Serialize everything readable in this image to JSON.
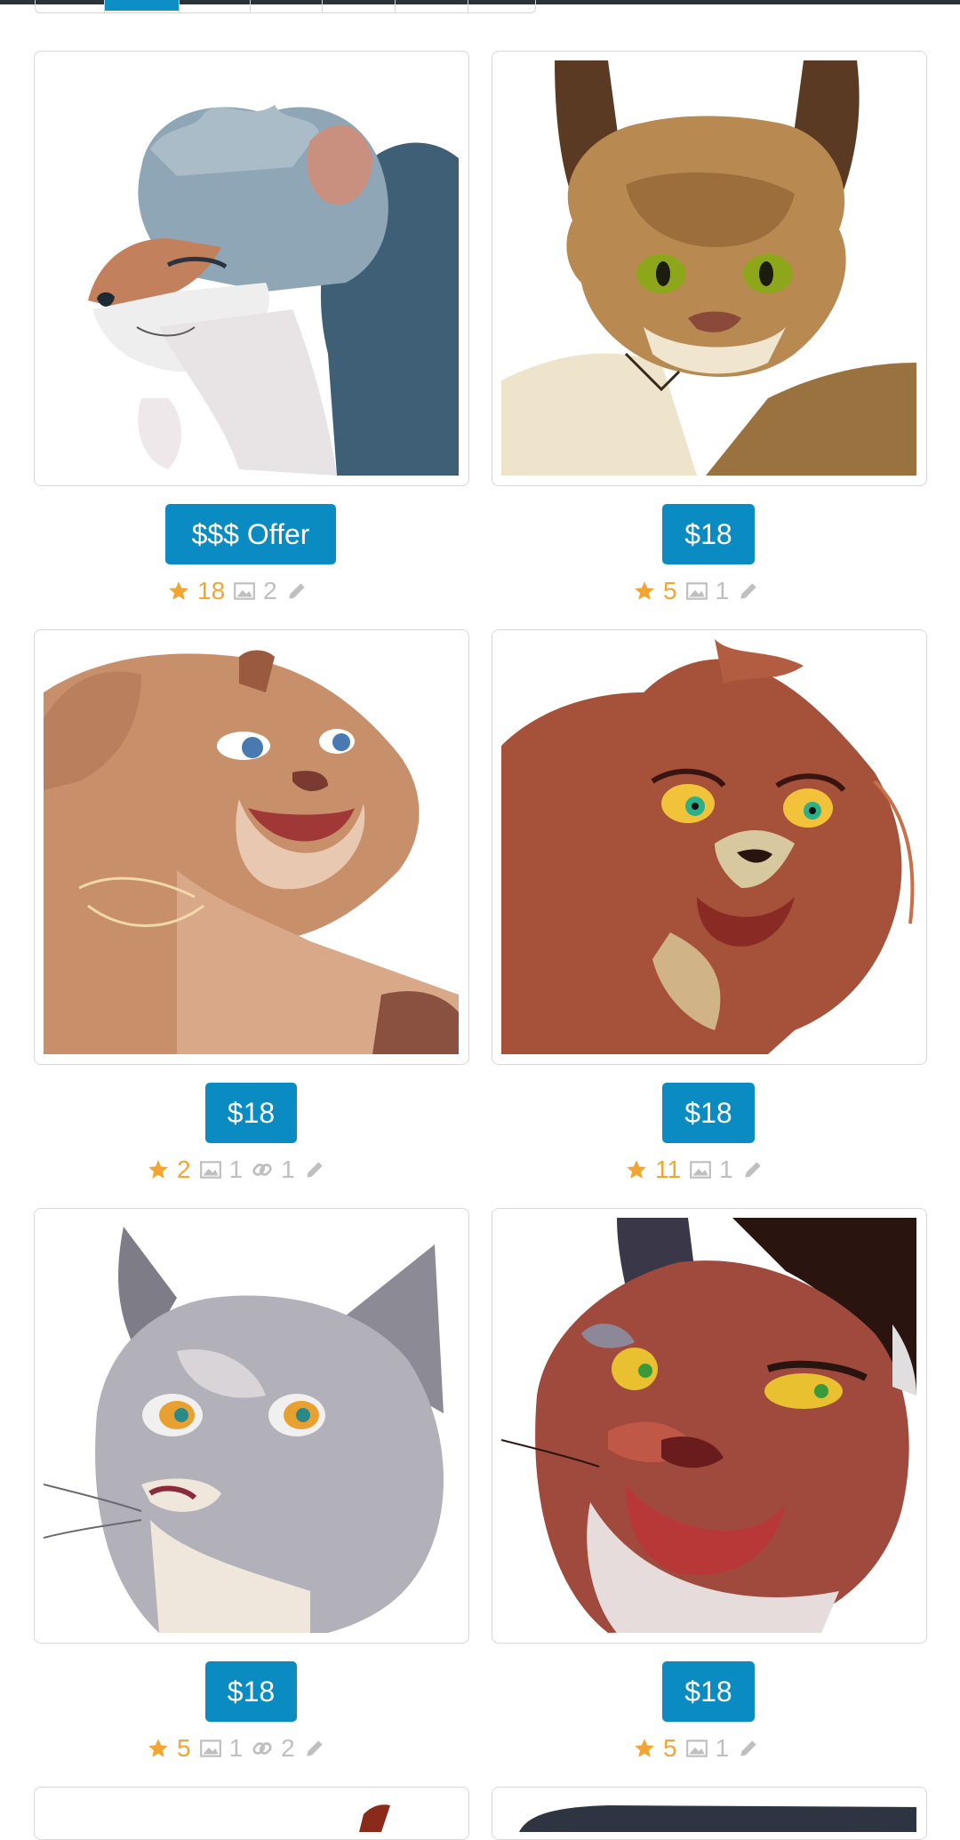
{
  "pagination": {
    "active_index": 1,
    "segment_count": 7
  },
  "colors": {
    "accent": "#0a8bc2",
    "star": "#f2a631",
    "muted": "#bfbfbf",
    "border": "#d8d8d8"
  },
  "listings": [
    {
      "price": "$$$ Offer",
      "favorites": "18",
      "images": "2",
      "links": "",
      "artist_icon": "pencil-icon",
      "art": "gray-blue-cat-profile-art"
    },
    {
      "price": "$18",
      "favorites": "5",
      "images": "1",
      "links": "",
      "artist_icon": "pencil-icon",
      "art": "brown-lynx-green-eyes-art"
    },
    {
      "price": "$18",
      "favorites": "2",
      "images": "1",
      "links": "1",
      "artist_icon": "pencil-icon",
      "art": "tan-cougar-smiling-art"
    },
    {
      "price": "$18",
      "favorites": "11",
      "images": "1",
      "links": "",
      "artist_icon": "pencil-icon",
      "art": "red-brown-cat-shocked-art"
    },
    {
      "price": "$18",
      "favorites": "5",
      "images": "1",
      "links": "2",
      "artist_icon": "pencil-icon",
      "art": "gray-cat-teal-eyes-art"
    },
    {
      "price": "$18",
      "favorites": "5",
      "images": "1",
      "links": "",
      "artist_icon": "pencil-icon",
      "art": "dark-red-cat-yellow-eyes-art"
    }
  ]
}
